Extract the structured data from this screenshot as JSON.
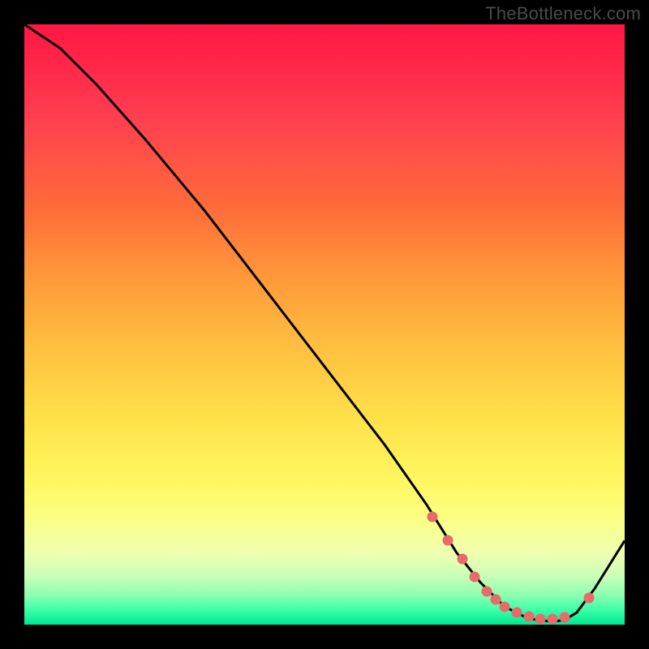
{
  "attribution": "TheBottleneck.com",
  "colors": {
    "page_bg": "#000000",
    "curve": "#000000",
    "dot": "#e86a6a",
    "gradient_top": "#ff1744",
    "gradient_bottom": "#00e890"
  },
  "chart_data": {
    "type": "line",
    "title": "",
    "xlabel": "",
    "ylabel": "",
    "xlim": [
      0,
      100
    ],
    "ylim": [
      0,
      100
    ],
    "grid": false,
    "legend": false,
    "series": [
      {
        "name": "curve",
        "x": [
          0,
          6,
          12,
          20,
          30,
          40,
          50,
          60,
          67,
          72,
          76,
          80,
          84,
          88,
          90,
          92,
          95,
          100
        ],
        "y": [
          100,
          96,
          90,
          81,
          69,
          56,
          43,
          30,
          20,
          12,
          7,
          3,
          1,
          0.5,
          0.8,
          2,
          6,
          14
        ]
      }
    ],
    "markers": {
      "name": "highlight-dots",
      "x": [
        68,
        70.5,
        73,
        75,
        77,
        78.5,
        80,
        82,
        84,
        86,
        88,
        90,
        94
      ],
      "y": [
        18,
        14,
        11,
        8,
        5.5,
        4.2,
        3,
        2,
        1.3,
        1,
        1,
        1.2,
        4.5
      ]
    }
  }
}
